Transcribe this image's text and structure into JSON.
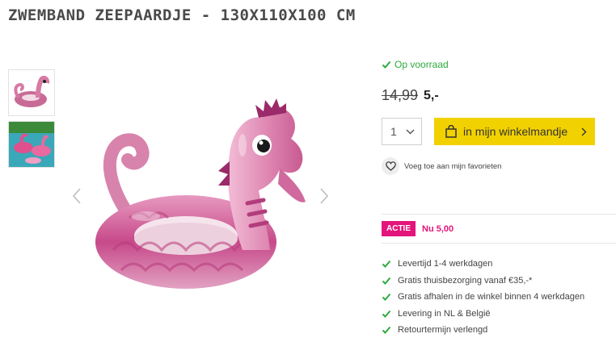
{
  "product": {
    "title": "ZWEMBAND ZEEPAARDJE - 130X110X100 CM"
  },
  "gallery": {
    "thumbnail_count": 2
  },
  "stock": {
    "label": "Op voorraad",
    "color": "#2dab3f"
  },
  "price": {
    "old": "14,99",
    "new": "5,-"
  },
  "quantity": {
    "value": "1"
  },
  "cart": {
    "label": "in mijn winkelmandje",
    "color": "#f2d100"
  },
  "favorite": {
    "label": "Voeg toe aan mijn favorieten"
  },
  "promo": {
    "badge": "ACTIE",
    "text": "Nu 5,00",
    "color": "#e3147b"
  },
  "usps": [
    "Levertijd 1-4 werkdagen",
    "Gratis thuisbezorging vanaf €35,-*",
    "Gratis afhalen in de winkel binnen 4 werkdagen",
    "Levering in NL & België",
    "Retourtermijn verlengd"
  ]
}
